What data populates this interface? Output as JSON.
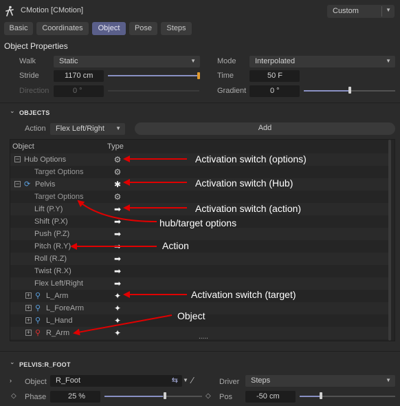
{
  "window": {
    "title": "CMotion [CMotion]",
    "preset": "Custom",
    "icon": "walking-figure-icon"
  },
  "tabs": [
    {
      "label": "Basic",
      "active": false
    },
    {
      "label": "Coordinates",
      "active": false
    },
    {
      "label": "Object",
      "active": true
    },
    {
      "label": "Pose",
      "active": false
    },
    {
      "label": "Steps",
      "active": false
    }
  ],
  "object_properties": {
    "heading": "Object Properties",
    "walk": {
      "label": "Walk",
      "value": "Static"
    },
    "mode": {
      "label": "Mode",
      "value": "Interpolated"
    },
    "stride": {
      "label": "Stride",
      "value": "1170 cm",
      "slider": 1.0
    },
    "time": {
      "label": "Time",
      "value": "50 F"
    },
    "direction": {
      "label": "Direction",
      "value": "0 °",
      "disabled": true
    },
    "gradient": {
      "label": "Gradient",
      "value": "0 °",
      "slider": 0.5
    }
  },
  "objects_section": {
    "title": "OBJECTS",
    "action_label": "Action",
    "action_value": "Flex Left/Right",
    "add_label": "Add",
    "columns": {
      "object": "Object",
      "type": "Type"
    },
    "rows": [
      {
        "name": "Hub Options",
        "indent": 0,
        "expander": "−",
        "type": "gear-icon",
        "glyph": "⚙"
      },
      {
        "name": "Target Options",
        "indent": 1,
        "type": "gear-icon",
        "glyph": "⚙",
        "dim": true
      },
      {
        "name": "Pelvis",
        "indent": 0,
        "expander": "−",
        "bone": true,
        "type": "asterisk-icon",
        "glyph": "✱"
      },
      {
        "name": "Target Options",
        "indent": 1,
        "type": "gear-icon",
        "glyph": "⚙",
        "dim": true
      },
      {
        "name": "Lift (P.Y)",
        "indent": 1,
        "type": "arrow-right-icon",
        "glyph": "➡"
      },
      {
        "name": "Shift (P.X)",
        "indent": 1,
        "type": "arrow-right-icon",
        "glyph": "➡"
      },
      {
        "name": "Push (P.Z)",
        "indent": 1,
        "type": "arrow-right-icon",
        "glyph": "➡"
      },
      {
        "name": "Pitch (R.Y)",
        "indent": 1,
        "type": "arrow-right-icon",
        "glyph": "➡"
      },
      {
        "name": "Roll (R.Z)",
        "indent": 1,
        "type": "arrow-right-icon",
        "glyph": "➡"
      },
      {
        "name": "Twist (R.X)",
        "indent": 1,
        "type": "arrow-right-icon",
        "glyph": "➡"
      },
      {
        "name": "Flex Left/Right",
        "indent": 1,
        "type": "arrow-right-icon",
        "glyph": "➡"
      },
      {
        "name": "L_Arm",
        "indent": 1,
        "expander": "+",
        "bone": true,
        "type": "target-icon",
        "glyph": "✦"
      },
      {
        "name": "L_ForeArm",
        "indent": 1,
        "expander": "+",
        "bone": true,
        "type": "target-icon",
        "glyph": "✦"
      },
      {
        "name": "L_Hand",
        "indent": 1,
        "expander": "+",
        "bone": true,
        "type": "target-icon",
        "glyph": "✦"
      },
      {
        "name": "R_Arm",
        "indent": 1,
        "expander": "+",
        "bone": true,
        "bone_red": true,
        "type": "target-icon",
        "glyph": "✦"
      }
    ],
    "grip": "....."
  },
  "annotations": [
    "Activation switch (options)",
    "Activation switch (Hub)",
    "Activation switch (action)",
    "hub/target options",
    "Action",
    "Activation switch (target)",
    "Object"
  ],
  "pelvis_section": {
    "title": "PELVIS:R_FOOT",
    "object_label": "Object",
    "object_value": "R_Foot",
    "driver_label": "Driver",
    "driver_value": "Steps",
    "phase_label": "Phase",
    "phase_value": "25 %",
    "phase_slider": 0.6,
    "pos_label": "Pos",
    "pos_value": "-50 cm",
    "pos_slider": 0.25
  },
  "colors": {
    "accent": "#5a5f8a",
    "arrow": "#e00000",
    "bone_blue": "#5aa0e0",
    "bone_red": "#e03030"
  }
}
